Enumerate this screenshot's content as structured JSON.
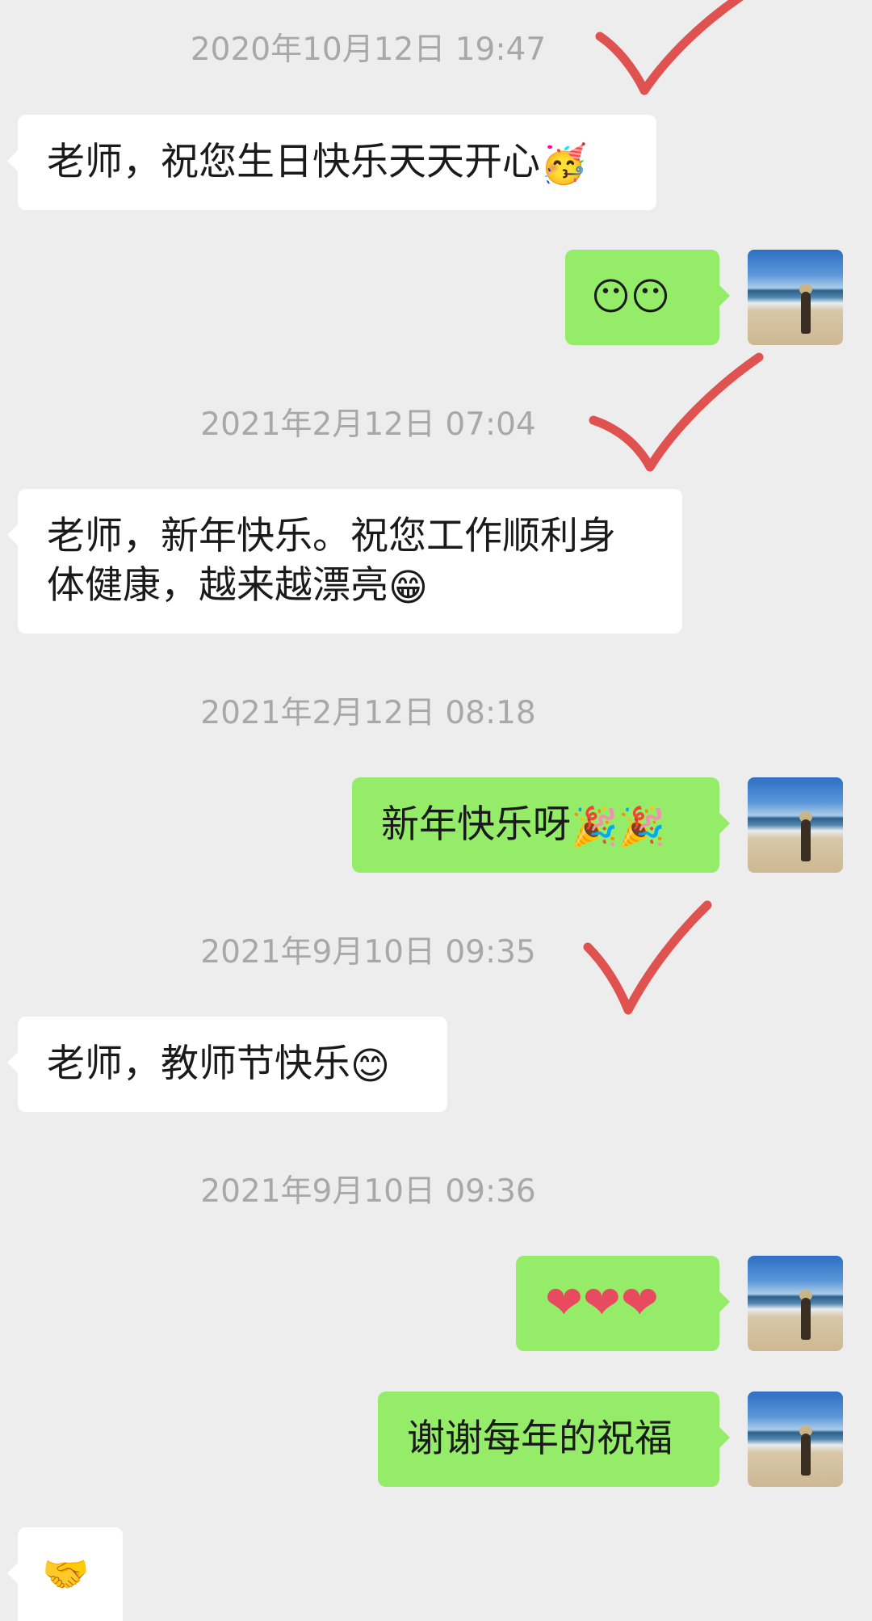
{
  "messages": {
    "ts1": "2020年10月12日 19:47",
    "m1": "老师，祝您生日快乐天天开心",
    "m1_emoji": "🥳",
    "m2": "😶😶",
    "ts2": "2021年2月12日 07:04",
    "m3_line1": "老师，新年快乐。祝您工作顺利身",
    "m3_line2": "体健康，越来越漂亮",
    "m3_emoji": "😁",
    "ts3": "2021年2月12日 08:18",
    "m4": "新年快乐呀",
    "m4_emoji": "🎉🎉",
    "ts4": "2021年9月10日 09:35",
    "m5": "老师，教师节快乐",
    "m5_emoji": "😊",
    "ts5": "2021年9月10日 09:36",
    "m6": "❤❤❤",
    "m7": "谢谢每年的祝福",
    "m8": "🤝"
  },
  "colors": {
    "background": "#ededed",
    "incoming_bubble": "#ffffff",
    "outgoing_bubble": "#95ec69",
    "timestamp_text": "#a8a8a8",
    "check_mark": "#e0524f",
    "heart": "#e84a5f"
  },
  "icons": {
    "check": "check-mark-icon",
    "avatar": "beach-photo-avatar"
  }
}
